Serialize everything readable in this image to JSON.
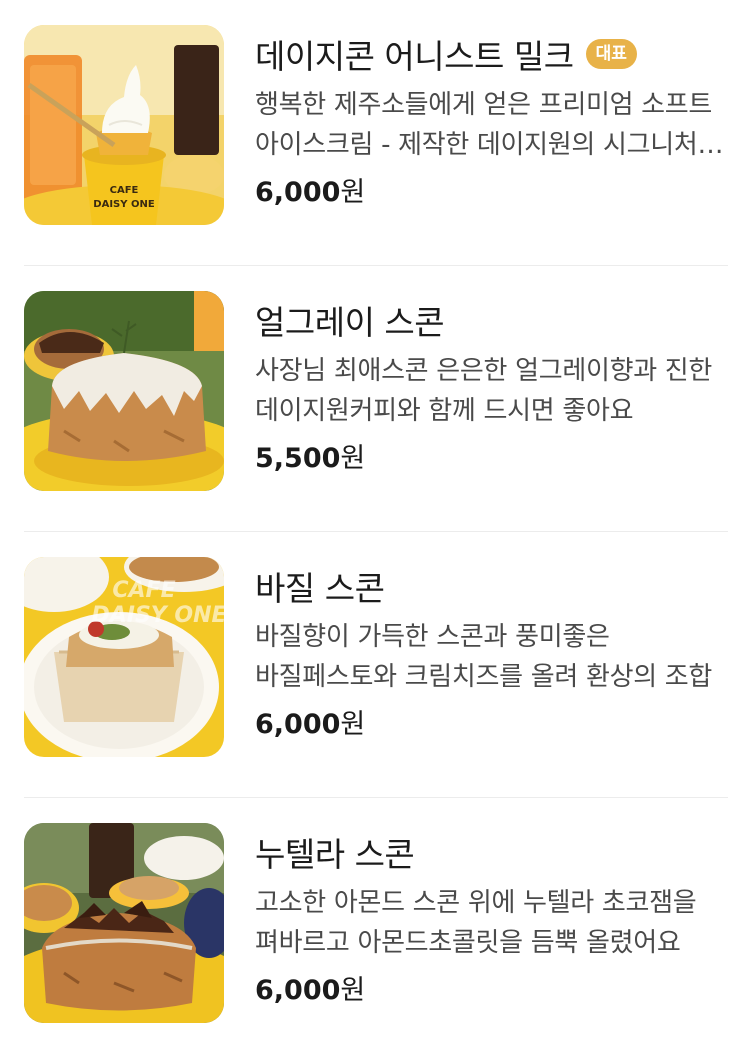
{
  "menu": {
    "items": [
      {
        "title": "데이지콘 어니스트 밀크",
        "badge": "대표",
        "description": "행복한 제주소들에게 얻은 프리미엄 소프트 아이스크림 - 제작한 데이지원의 시그니처 메뉴",
        "price_amount": "6,000",
        "price_unit": "원",
        "image": "soft-serve-ice-cream-cup-photo"
      },
      {
        "title": "얼그레이 스콘",
        "badge": "",
        "description": "사장님 최애스콘 은은한 얼그레이향과 진한 데이지원커피와 함께 드시면 좋아요",
        "price_amount": "5,500",
        "price_unit": "원",
        "image": "earl-grey-scone-photo"
      },
      {
        "title": "바질 스콘",
        "badge": "",
        "description": "바질향이 가득한 스콘과 풍미좋은 바질페스토와 크림치즈를 올려 환상의 조합",
        "price_amount": "6,000",
        "price_unit": "원",
        "image": "basil-scone-photo"
      },
      {
        "title": "누텔라 스콘",
        "badge": "",
        "description": "고소한 아몬드 스콘 위에 누텔라 초코잼을 펴바르고 아몬드초콜릿을 듬뿍 올렸어요",
        "price_amount": "6,000",
        "price_unit": "원",
        "image": "nutella-scone-photo"
      }
    ]
  },
  "colors": {
    "badge": "#e8b248",
    "divider": "#ececec",
    "title": "#1b1b1b",
    "description": "#4a4a4a"
  }
}
